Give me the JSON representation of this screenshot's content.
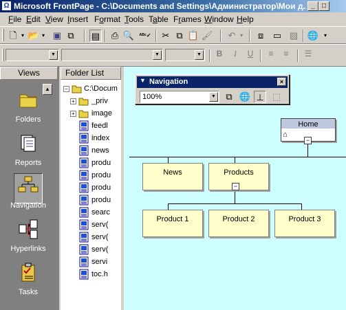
{
  "window": {
    "title": "Microsoft FrontPage - C:\\Documents and Settings\\Администратор\\Мои д...",
    "app_icon": "frontpage-icon",
    "buttons": {
      "minimize": "_",
      "restore": "□"
    }
  },
  "menu": {
    "items": [
      {
        "label": "File",
        "key": "F",
        "rest": "ile"
      },
      {
        "label": "Edit",
        "key": "E",
        "rest": "dit"
      },
      {
        "label": "View",
        "key": "V",
        "rest": "iew"
      },
      {
        "label": "Insert",
        "key": "I",
        "rest": "nsert"
      },
      {
        "label": "Format",
        "key": "o",
        "pre": "F",
        "rest": "rmat"
      },
      {
        "label": "Tools",
        "key": "T",
        "rest": "ools"
      },
      {
        "label": "Table",
        "key": "a",
        "pre": "T",
        "rest": "ble"
      },
      {
        "label": "Frames",
        "key": "r",
        "pre": "F",
        "rest": "ames"
      },
      {
        "label": "Window",
        "key": "W",
        "rest": "indow"
      },
      {
        "label": "Help",
        "key": "H",
        "rest": "elp"
      }
    ]
  },
  "formatting_toolbar": {
    "bold": "B",
    "italic": "I",
    "underline": "U"
  },
  "views_pane": {
    "header": "Views",
    "items": [
      {
        "label": "Folders",
        "icon": "folder-icon"
      },
      {
        "label": "Reports",
        "icon": "reports-icon"
      },
      {
        "label": "Navigation",
        "icon": "navigation-icon",
        "selected": true
      },
      {
        "label": "Hyperlinks",
        "icon": "hyperlinks-icon"
      },
      {
        "label": "Tasks",
        "icon": "tasks-icon"
      }
    ]
  },
  "folder_list": {
    "header": "Folder List",
    "root": "C:\\Docum",
    "items": [
      {
        "name": "_priv",
        "type": "folder"
      },
      {
        "name": "image",
        "type": "folder"
      },
      {
        "name": "feedl",
        "type": "page"
      },
      {
        "name": "index",
        "type": "page"
      },
      {
        "name": "news",
        "type": "page"
      },
      {
        "name": "produ",
        "type": "page"
      },
      {
        "name": "produ",
        "type": "page"
      },
      {
        "name": "produ",
        "type": "page"
      },
      {
        "name": "produ",
        "type": "page"
      },
      {
        "name": "searc",
        "type": "page"
      },
      {
        "name": "serv(",
        "type": "page"
      },
      {
        "name": "serv(",
        "type": "page"
      },
      {
        "name": "serv(",
        "type": "page"
      },
      {
        "name": "servi",
        "type": "page"
      },
      {
        "name": "toc.h",
        "type": "page"
      }
    ]
  },
  "navigation_toolbar": {
    "title": "Navigation",
    "zoom": "100%"
  },
  "navigation_tree": {
    "home": "Home",
    "level1": [
      "News",
      "Products"
    ],
    "level2": [
      "Product 1",
      "Product 2",
      "Product 3"
    ]
  },
  "colors": {
    "title_bar": "#0a246a",
    "canvas": "#cdfffe",
    "node_fill": "#ffffcc"
  }
}
